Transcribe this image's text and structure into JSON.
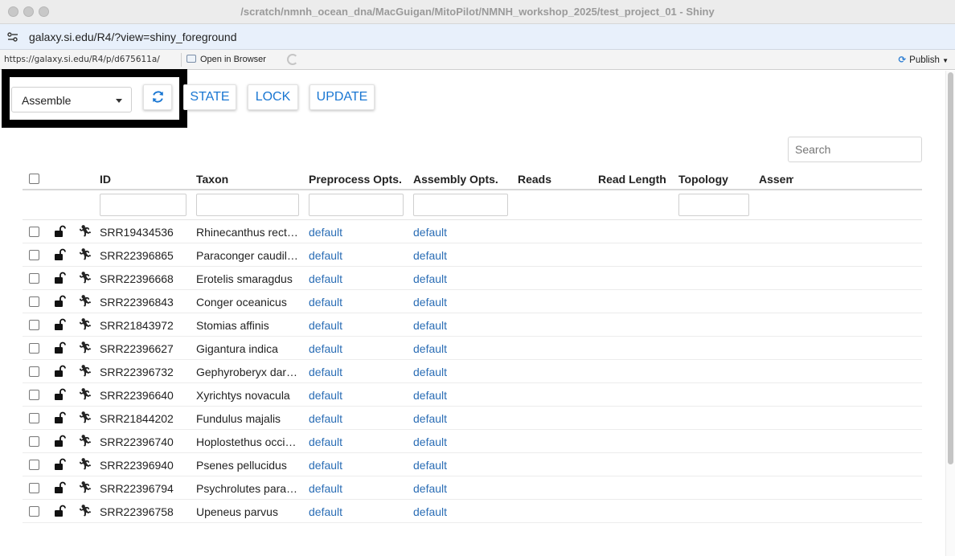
{
  "window": {
    "title": "/scratch/nmnh_ocean_dna/MacGuigan/MitoPilot/NMNH_workshop_2025/test_project_01 - Shiny"
  },
  "browser": {
    "url": "galaxy.si.edu/R4/?view=shiny_foreground",
    "app_address": "https://galaxy.si.edu/R4/p/d675611a/",
    "open_in_browser": "Open in Browser",
    "publish": "Publish"
  },
  "controls": {
    "mode_select": "Assemble",
    "state_button": "STATE",
    "lock_button": "LOCK",
    "update_button": "UPDATE",
    "search_placeholder": "Search"
  },
  "table": {
    "columns": [
      "ID",
      "Taxon",
      "Preprocess Opts.",
      "Assembly Opts.",
      "Reads",
      "Read Length",
      "Topology",
      "Assem"
    ],
    "rows": [
      {
        "id": "SRR19434536",
        "taxon": "Rhinecanthus rect…",
        "preprocess": "default",
        "assembly": "default"
      },
      {
        "id": "SRR22396865",
        "taxon": "Paraconger caudil…",
        "preprocess": "default",
        "assembly": "default"
      },
      {
        "id": "SRR22396668",
        "taxon": "Erotelis smaragdus",
        "preprocess": "default",
        "assembly": "default"
      },
      {
        "id": "SRR22396843",
        "taxon": "Conger oceanicus",
        "preprocess": "default",
        "assembly": "default"
      },
      {
        "id": "SRR21843972",
        "taxon": "Stomias affinis",
        "preprocess": "default",
        "assembly": "default"
      },
      {
        "id": "SRR22396627",
        "taxon": "Gigantura indica",
        "preprocess": "default",
        "assembly": "default"
      },
      {
        "id": "SRR22396732",
        "taxon": "Gephyroberyx dar…",
        "preprocess": "default",
        "assembly": "default"
      },
      {
        "id": "SRR22396640",
        "taxon": "Xyrichtys novacula",
        "preprocess": "default",
        "assembly": "default"
      },
      {
        "id": "SRR21844202",
        "taxon": "Fundulus majalis",
        "preprocess": "default",
        "assembly": "default"
      },
      {
        "id": "SRR22396740",
        "taxon": "Hoplostethus occi…",
        "preprocess": "default",
        "assembly": "default"
      },
      {
        "id": "SRR22396940",
        "taxon": "Psenes pellucidus",
        "preprocess": "default",
        "assembly": "default"
      },
      {
        "id": "SRR22396794",
        "taxon": "Psychrolutes para…",
        "preprocess": "default",
        "assembly": "default"
      },
      {
        "id": "SRR22396758",
        "taxon": "Upeneus parvus",
        "preprocess": "default",
        "assembly": "default"
      }
    ]
  }
}
